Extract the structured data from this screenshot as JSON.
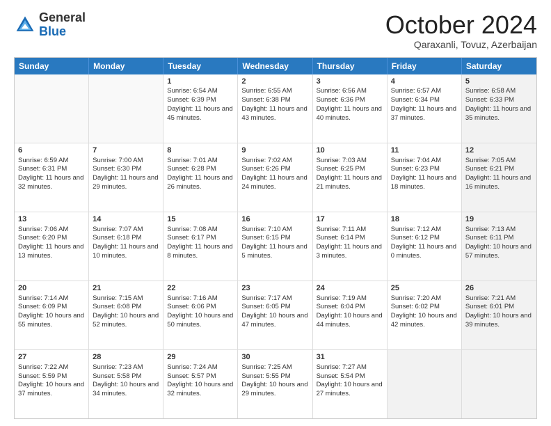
{
  "logo": {
    "general": "General",
    "blue": "Blue"
  },
  "header": {
    "month": "October 2024",
    "location": "Qaraxanli, Tovuz, Azerbaijan"
  },
  "days": [
    "Sunday",
    "Monday",
    "Tuesday",
    "Wednesday",
    "Thursday",
    "Friday",
    "Saturday"
  ],
  "weeks": [
    [
      {
        "day": "",
        "empty": true
      },
      {
        "day": "",
        "empty": true
      },
      {
        "day": "1",
        "sunrise": "Sunrise: 6:54 AM",
        "sunset": "Sunset: 6:39 PM",
        "daylight": "Daylight: 11 hours and 45 minutes."
      },
      {
        "day": "2",
        "sunrise": "Sunrise: 6:55 AM",
        "sunset": "Sunset: 6:38 PM",
        "daylight": "Daylight: 11 hours and 43 minutes."
      },
      {
        "day": "3",
        "sunrise": "Sunrise: 6:56 AM",
        "sunset": "Sunset: 6:36 PM",
        "daylight": "Daylight: 11 hours and 40 minutes."
      },
      {
        "day": "4",
        "sunrise": "Sunrise: 6:57 AM",
        "sunset": "Sunset: 6:34 PM",
        "daylight": "Daylight: 11 hours and 37 minutes."
      },
      {
        "day": "5",
        "sunrise": "Sunrise: 6:58 AM",
        "sunset": "Sunset: 6:33 PM",
        "daylight": "Daylight: 11 hours and 35 minutes.",
        "shaded": true
      }
    ],
    [
      {
        "day": "6",
        "sunrise": "Sunrise: 6:59 AM",
        "sunset": "Sunset: 6:31 PM",
        "daylight": "Daylight: 11 hours and 32 minutes."
      },
      {
        "day": "7",
        "sunrise": "Sunrise: 7:00 AM",
        "sunset": "Sunset: 6:30 PM",
        "daylight": "Daylight: 11 hours and 29 minutes."
      },
      {
        "day": "8",
        "sunrise": "Sunrise: 7:01 AM",
        "sunset": "Sunset: 6:28 PM",
        "daylight": "Daylight: 11 hours and 26 minutes."
      },
      {
        "day": "9",
        "sunrise": "Sunrise: 7:02 AM",
        "sunset": "Sunset: 6:26 PM",
        "daylight": "Daylight: 11 hours and 24 minutes."
      },
      {
        "day": "10",
        "sunrise": "Sunrise: 7:03 AM",
        "sunset": "Sunset: 6:25 PM",
        "daylight": "Daylight: 11 hours and 21 minutes."
      },
      {
        "day": "11",
        "sunrise": "Sunrise: 7:04 AM",
        "sunset": "Sunset: 6:23 PM",
        "daylight": "Daylight: 11 hours and 18 minutes."
      },
      {
        "day": "12",
        "sunrise": "Sunrise: 7:05 AM",
        "sunset": "Sunset: 6:21 PM",
        "daylight": "Daylight: 11 hours and 16 minutes.",
        "shaded": true
      }
    ],
    [
      {
        "day": "13",
        "sunrise": "Sunrise: 7:06 AM",
        "sunset": "Sunset: 6:20 PM",
        "daylight": "Daylight: 11 hours and 13 minutes."
      },
      {
        "day": "14",
        "sunrise": "Sunrise: 7:07 AM",
        "sunset": "Sunset: 6:18 PM",
        "daylight": "Daylight: 11 hours and 10 minutes."
      },
      {
        "day": "15",
        "sunrise": "Sunrise: 7:08 AM",
        "sunset": "Sunset: 6:17 PM",
        "daylight": "Daylight: 11 hours and 8 minutes."
      },
      {
        "day": "16",
        "sunrise": "Sunrise: 7:10 AM",
        "sunset": "Sunset: 6:15 PM",
        "daylight": "Daylight: 11 hours and 5 minutes."
      },
      {
        "day": "17",
        "sunrise": "Sunrise: 7:11 AM",
        "sunset": "Sunset: 6:14 PM",
        "daylight": "Daylight: 11 hours and 3 minutes."
      },
      {
        "day": "18",
        "sunrise": "Sunrise: 7:12 AM",
        "sunset": "Sunset: 6:12 PM",
        "daylight": "Daylight: 11 hours and 0 minutes."
      },
      {
        "day": "19",
        "sunrise": "Sunrise: 7:13 AM",
        "sunset": "Sunset: 6:11 PM",
        "daylight": "Daylight: 10 hours and 57 minutes.",
        "shaded": true
      }
    ],
    [
      {
        "day": "20",
        "sunrise": "Sunrise: 7:14 AM",
        "sunset": "Sunset: 6:09 PM",
        "daylight": "Daylight: 10 hours and 55 minutes."
      },
      {
        "day": "21",
        "sunrise": "Sunrise: 7:15 AM",
        "sunset": "Sunset: 6:08 PM",
        "daylight": "Daylight: 10 hours and 52 minutes."
      },
      {
        "day": "22",
        "sunrise": "Sunrise: 7:16 AM",
        "sunset": "Sunset: 6:06 PM",
        "daylight": "Daylight: 10 hours and 50 minutes."
      },
      {
        "day": "23",
        "sunrise": "Sunrise: 7:17 AM",
        "sunset": "Sunset: 6:05 PM",
        "daylight": "Daylight: 10 hours and 47 minutes."
      },
      {
        "day": "24",
        "sunrise": "Sunrise: 7:19 AM",
        "sunset": "Sunset: 6:04 PM",
        "daylight": "Daylight: 10 hours and 44 minutes."
      },
      {
        "day": "25",
        "sunrise": "Sunrise: 7:20 AM",
        "sunset": "Sunset: 6:02 PM",
        "daylight": "Daylight: 10 hours and 42 minutes."
      },
      {
        "day": "26",
        "sunrise": "Sunrise: 7:21 AM",
        "sunset": "Sunset: 6:01 PM",
        "daylight": "Daylight: 10 hours and 39 minutes.",
        "shaded": true
      }
    ],
    [
      {
        "day": "27",
        "sunrise": "Sunrise: 7:22 AM",
        "sunset": "Sunset: 5:59 PM",
        "daylight": "Daylight: 10 hours and 37 minutes."
      },
      {
        "day": "28",
        "sunrise": "Sunrise: 7:23 AM",
        "sunset": "Sunset: 5:58 PM",
        "daylight": "Daylight: 10 hours and 34 minutes."
      },
      {
        "day": "29",
        "sunrise": "Sunrise: 7:24 AM",
        "sunset": "Sunset: 5:57 PM",
        "daylight": "Daylight: 10 hours and 32 minutes."
      },
      {
        "day": "30",
        "sunrise": "Sunrise: 7:25 AM",
        "sunset": "Sunset: 5:55 PM",
        "daylight": "Daylight: 10 hours and 29 minutes."
      },
      {
        "day": "31",
        "sunrise": "Sunrise: 7:27 AM",
        "sunset": "Sunset: 5:54 PM",
        "daylight": "Daylight: 10 hours and 27 minutes."
      },
      {
        "day": "",
        "empty": true,
        "shaded": true
      },
      {
        "day": "",
        "empty": true,
        "shaded": true
      }
    ]
  ]
}
